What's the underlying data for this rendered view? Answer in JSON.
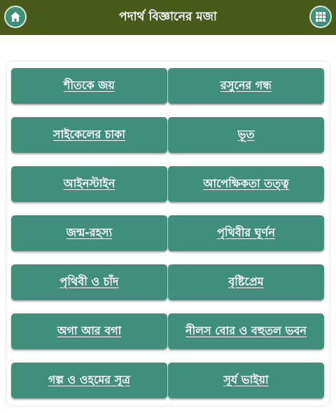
{
  "app": {
    "title": "পদার্থ বিজ্ঞানের মজা",
    "colors": {
      "header": "#4a5a1a",
      "button": "#3f8f7a",
      "text": "#ffffff"
    }
  },
  "header": {
    "left_icon": "home-icon",
    "right_icon": "grid-menu-icon"
  },
  "topics": [
    "শীতকে জয়",
    "রসুনের গন্ধ",
    "সাইকেলের চাকা",
    "ভূত",
    "আইনস্টাইন",
    "আপেক্ষিকতা তত্ত্ব",
    "জন্ম-রহস্য",
    "পৃথিবীর ঘূর্ণন",
    "পৃথিবী ও চাঁদ",
    "বৃষ্টিপ্রেম",
    "অগা আর বগা",
    "নীলস বোর ও বহুতল ভবন",
    "গল্প ও ওহমের সূত্র",
    "সূর্য ভাইয়া"
  ]
}
